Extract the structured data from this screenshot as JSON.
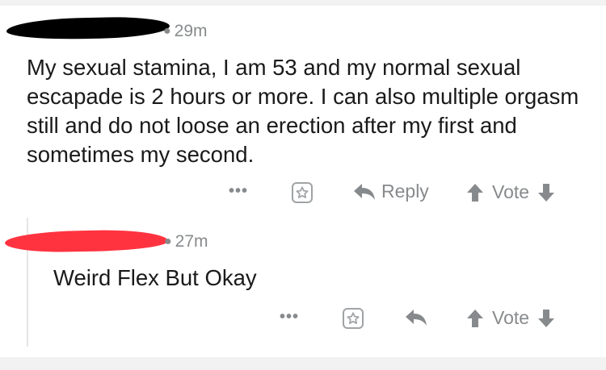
{
  "comment": {
    "time": "29m",
    "text": "My sexual stamina, I am 53 and my normal sexual escapade is 2 hours or more. I can also multiple orgasm still and do not loose an erection after my first and sometimes my second.",
    "actions": {
      "more": "•••",
      "reply": "Reply",
      "vote": "Vote"
    }
  },
  "reply": {
    "time": "27m",
    "text": "Weird Flex But Okay",
    "actions": {
      "more": "•••",
      "vote": "Vote"
    }
  },
  "colors": {
    "redaction_top": "#000000",
    "redaction_reply": "#ff3340",
    "meta": "#878a8c"
  },
  "icons": [
    "more-icon",
    "star-icon",
    "reply-icon",
    "upvote-icon",
    "downvote-icon"
  ]
}
